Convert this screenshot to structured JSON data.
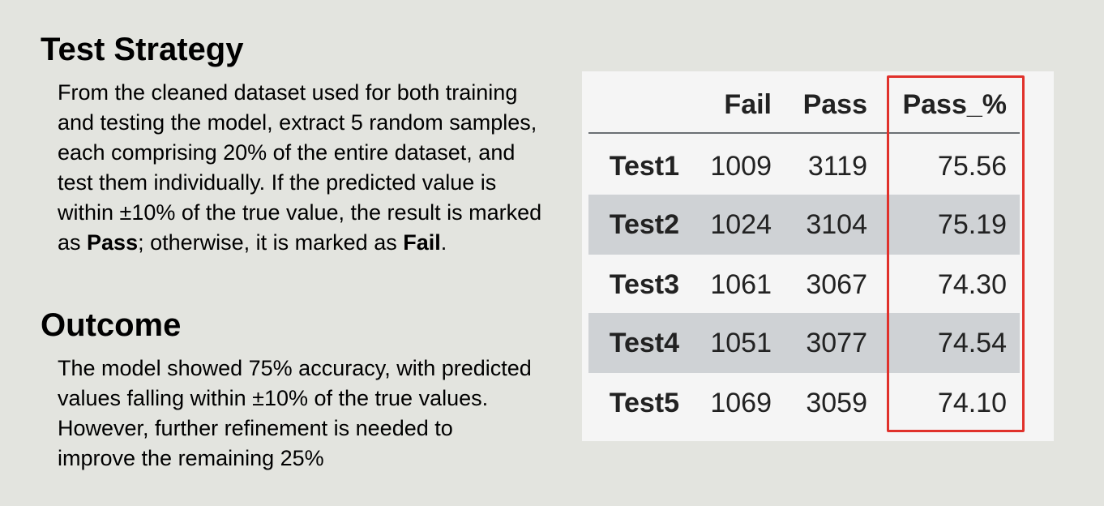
{
  "strategy": {
    "heading": "Test Strategy",
    "text_pre": "From the cleaned dataset used for both training and testing the model, extract 5 random samples, each comprising 20% of the entire dataset, and test them individually. If the predicted value is within ±10% of the true value, the result is marked as ",
    "pass_word": "Pass",
    "text_mid": "; otherwise, it is marked as ",
    "fail_word": "Fail",
    "text_end": "."
  },
  "outcome": {
    "heading": "Outcome",
    "text": "The model showed 75% accuracy, with predicted values falling within ±10% of the true values. However, further refinement is needed to improve the remaining 25%"
  },
  "table": {
    "columns": [
      "",
      "Fail",
      "Pass",
      "Pass_%"
    ],
    "rows": [
      {
        "name": "Test1",
        "fail": "1009",
        "pass": "3119",
        "pct": "75.56"
      },
      {
        "name": "Test2",
        "fail": "1024",
        "pass": "3104",
        "pct": "75.19"
      },
      {
        "name": "Test3",
        "fail": "1061",
        "pass": "3067",
        "pct": "74.30"
      },
      {
        "name": "Test4",
        "fail": "1051",
        "pass": "3077",
        "pct": "74.54"
      },
      {
        "name": "Test5",
        "fail": "1069",
        "pass": "3059",
        "pct": "74.10"
      }
    ],
    "highlight_color": "#e0312b"
  }
}
